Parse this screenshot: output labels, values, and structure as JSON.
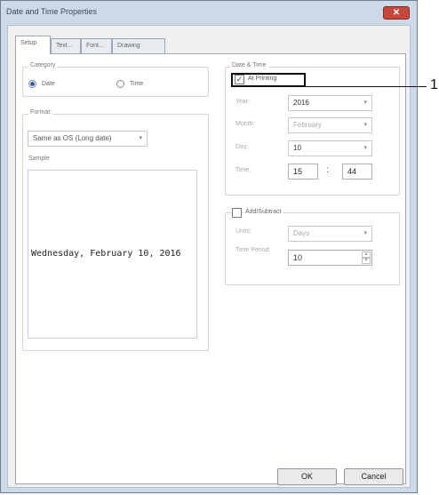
{
  "window": {
    "title": "Date and Time Properties",
    "close_glyph": "✕"
  },
  "tabs": [
    "Setup",
    "Text...",
    "Font...",
    "Drawing"
  ],
  "category": {
    "label": "Category",
    "options": [
      "Date",
      "Time"
    ],
    "selected": "Date"
  },
  "format": {
    "label": "Format:",
    "value": "Same as OS (Long date)",
    "sample_label": "Sample",
    "sample_text": "Wednesday, February 10, 2016"
  },
  "date_time": {
    "label": "Date & Time",
    "at_printing_label": "At Printing",
    "at_printing_checked": true,
    "year_label": "Year:",
    "year_value": "2016",
    "month_label": "Month:",
    "month_value": "February",
    "day_label": "Day:",
    "day_value": "10",
    "time_label": "Time:",
    "hour_value": "15",
    "separator": ":",
    "minute_value": "44"
  },
  "add_subtract": {
    "label": "Add/Subtract",
    "checked": false,
    "units_label": "Units:",
    "units_value": "Days",
    "period_label": "Time Period:",
    "period_value": "10"
  },
  "buttons": {
    "ok": "OK",
    "cancel": "Cancel"
  },
  "callout": {
    "number": "1"
  },
  "icons": {
    "dropdown": "▾",
    "spin_up": "▴",
    "spin_down": "▾",
    "check": "✓"
  },
  "colors": {
    "title_bar": "#cdd9e6",
    "close_button": "#c9463d",
    "selected_radio": "#2a5fb0"
  }
}
